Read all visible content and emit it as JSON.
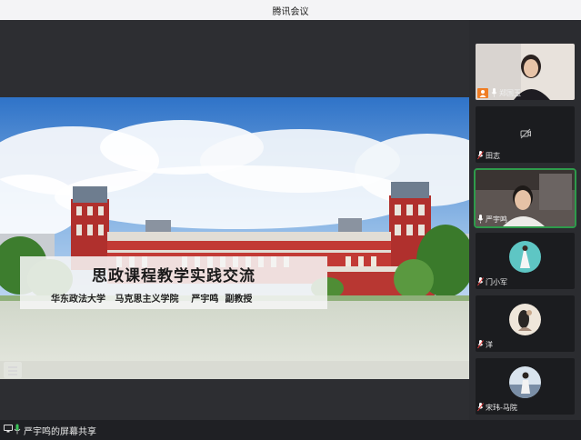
{
  "window": {
    "title": "腾讯会议"
  },
  "slide": {
    "title": "思政课程教学实践交流",
    "subtitle": "华东政法大学   马克思主义学院    严宇鸣  副教授"
  },
  "bottom_bar": {
    "share_status": "严宇鸣的屏幕共享",
    "icons": [
      "screen-share-icon",
      "mic-icon"
    ]
  },
  "participants": [
    {
      "name": "郑国玉",
      "video": "camera",
      "mic": "on"
    },
    {
      "name": "田志",
      "video": "off",
      "mic": "muted"
    },
    {
      "name": "严宇鸣",
      "video": "camera",
      "mic": "on",
      "speaking": true
    },
    {
      "name": "门小军",
      "video": "avatar",
      "mic": "muted"
    },
    {
      "name": "洋",
      "video": "avatar",
      "mic": "muted"
    },
    {
      "name": "宋玮-马院",
      "video": "avatar",
      "mic": "muted"
    }
  ],
  "colors": {
    "titlebar": "#f4f4f6",
    "background": "#2b2c30",
    "active_speaker_border": "#2e9b4b",
    "building_red": "#b0302d"
  }
}
